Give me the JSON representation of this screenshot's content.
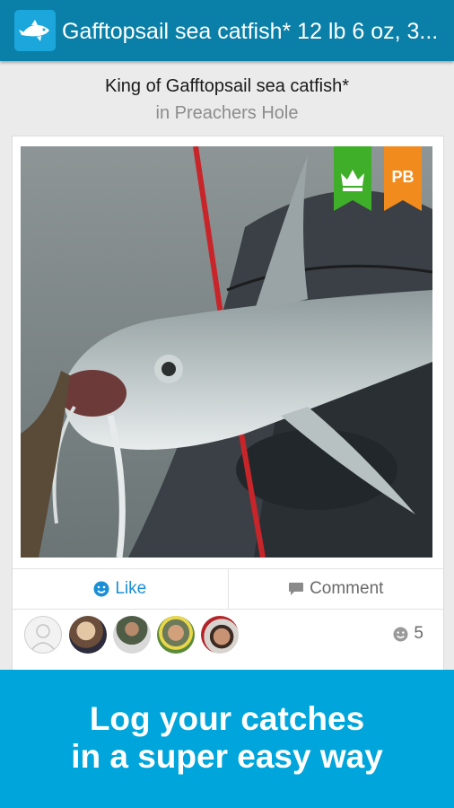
{
  "app_bar": {
    "title": "Gafftopsail sea catfish* 12 lb 6 oz, 3...",
    "logo_icon": "fish-logo-icon",
    "color": "#0a7fa8"
  },
  "header": {
    "title": "King of Gafftopsail sea catfish*",
    "subtitle": "in Preachers Hole"
  },
  "post": {
    "badges": [
      {
        "name": "king-crown-badge",
        "label": "",
        "color": "#3fae29"
      },
      {
        "name": "pb-badge",
        "label": "PB",
        "color": "#f28b1d"
      }
    ],
    "actions": {
      "like_label": "Like",
      "comment_label": "Comment"
    },
    "likes_count": "5"
  },
  "banner": {
    "line1": "Log your catches",
    "line2": "in a super easy way",
    "color": "#00a6db"
  }
}
